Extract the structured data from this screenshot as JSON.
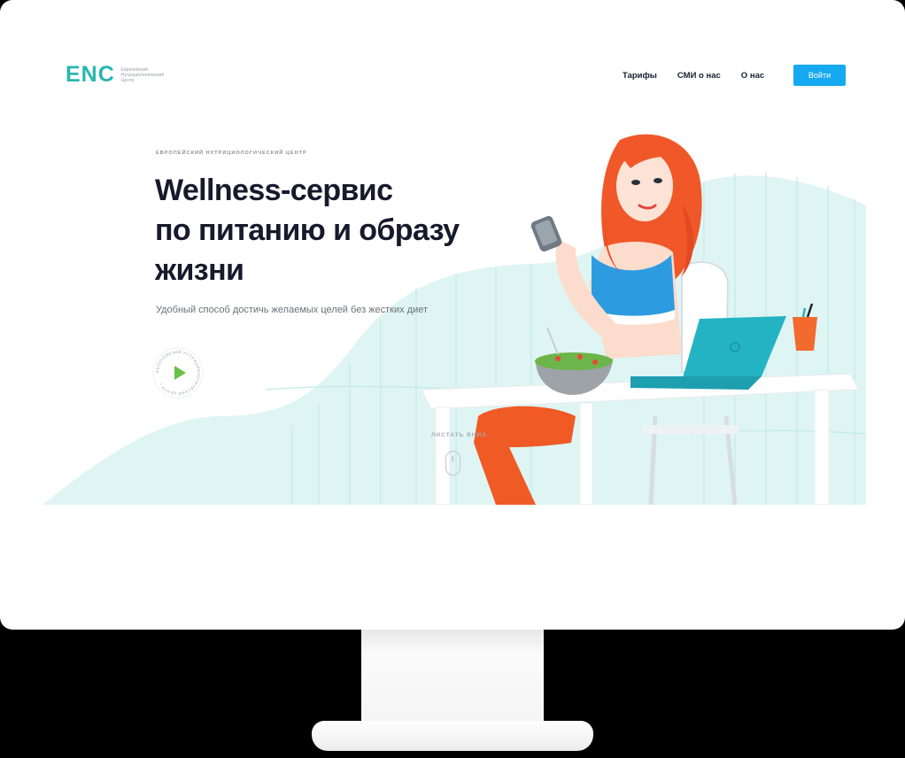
{
  "header": {
    "logo_mark": "ENC",
    "logo_text": "Европейский Нутрициологический Центр",
    "nav": [
      {
        "label": "Тарифы"
      },
      {
        "label": "СМИ о нас"
      },
      {
        "label": "О нас"
      }
    ],
    "login_label": "Войти"
  },
  "hero": {
    "eyebrow": "Европейский нутрициологический центр",
    "title_lines": [
      "Wellness-сервис",
      "по питанию и образу",
      "жизни"
    ],
    "subtitle": "Удобный способ достичь желаемых целей без жестких диет",
    "play_ring_text": "ЕВРОПЕЙСКИЙ НУТРИЦИОЛОГИЧЕСКИЙ ЦЕНТР • ",
    "scroll_label": "Листать вниз"
  },
  "colors": {
    "accent": "#16a9f2",
    "brand": "#27b7b0",
    "mint": "#dff5f3",
    "play": "#6cc04a",
    "hair": "#f0582a"
  },
  "icons": {
    "play": "play-icon",
    "scroll": "mouse-icon"
  }
}
